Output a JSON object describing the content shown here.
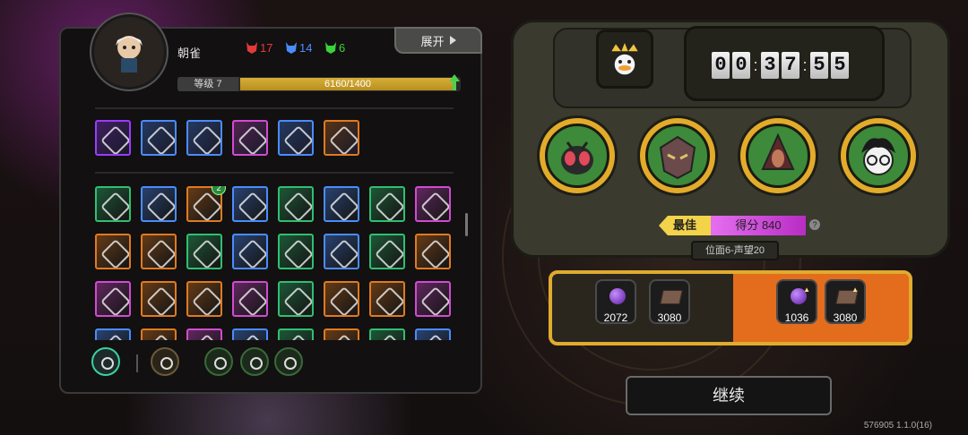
{
  "player": {
    "name": "朝雀",
    "level_label": "等级 7",
    "xp_text": "6160/1400",
    "xp_fraction": 1.0
  },
  "resources": [
    {
      "value": "17",
      "color": "#e23a3a",
      "icon": "red-mask-icon"
    },
    {
      "value": "14",
      "color": "#4a8cff",
      "icon": "blue-mask-icon"
    },
    {
      "value": "6",
      "color": "#3ad23a",
      "icon": "green-mask-icon"
    }
  ],
  "expand_label": "展开",
  "skill_row_colors": [
    "#9a3cff",
    "#4a8cff",
    "#4a8cff",
    "#d24ad2",
    "#4a8cff",
    "#e07a20"
  ],
  "relic_colors": [
    "#2ec070",
    "#4a8cff",
    "#e07a20",
    "#4a8cff",
    "#2ec070",
    "#4a8cff",
    "#2ec070",
    "#d24ad2",
    "#e07a20",
    "#e07a20",
    "#2ec070",
    "#4a8cff",
    "#2ec070",
    "#4a8cff",
    "#2ec070",
    "#e07a20",
    "#d24ad2",
    "#e07a20",
    "#e07a20",
    "#d24ad2",
    "#2ec070",
    "#e07a20",
    "#e07a20",
    "#d24ad2",
    "#4a8cff",
    "#e07a20",
    "#d24ad2",
    "#4a8cff",
    "#2ec070",
    "#e07a20",
    "#2ec070",
    "#4a8cff"
  ],
  "relic_badge": "2",
  "timer": {
    "digits": [
      "0",
      "0",
      "3",
      "7",
      "5",
      "5"
    ]
  },
  "bosses": [
    "insect-boss-icon",
    "armored-boss-icon",
    "hooded-boss-icon",
    "glasses-boy-icon"
  ],
  "best_label": "最佳",
  "score_label": "得分 840",
  "plane_label": "位面6-声望20",
  "rewards": {
    "base": [
      {
        "icon": "purple-gem-icon",
        "value": "2072"
      },
      {
        "icon": "brick-icon",
        "value": "3080"
      }
    ],
    "bonus": [
      {
        "icon": "purple-gem-up-icon",
        "value": "1036"
      },
      {
        "icon": "brick-up-icon",
        "value": "3080"
      }
    ]
  },
  "continue_label": "继续",
  "version": "576905 1.1.0(16)"
}
